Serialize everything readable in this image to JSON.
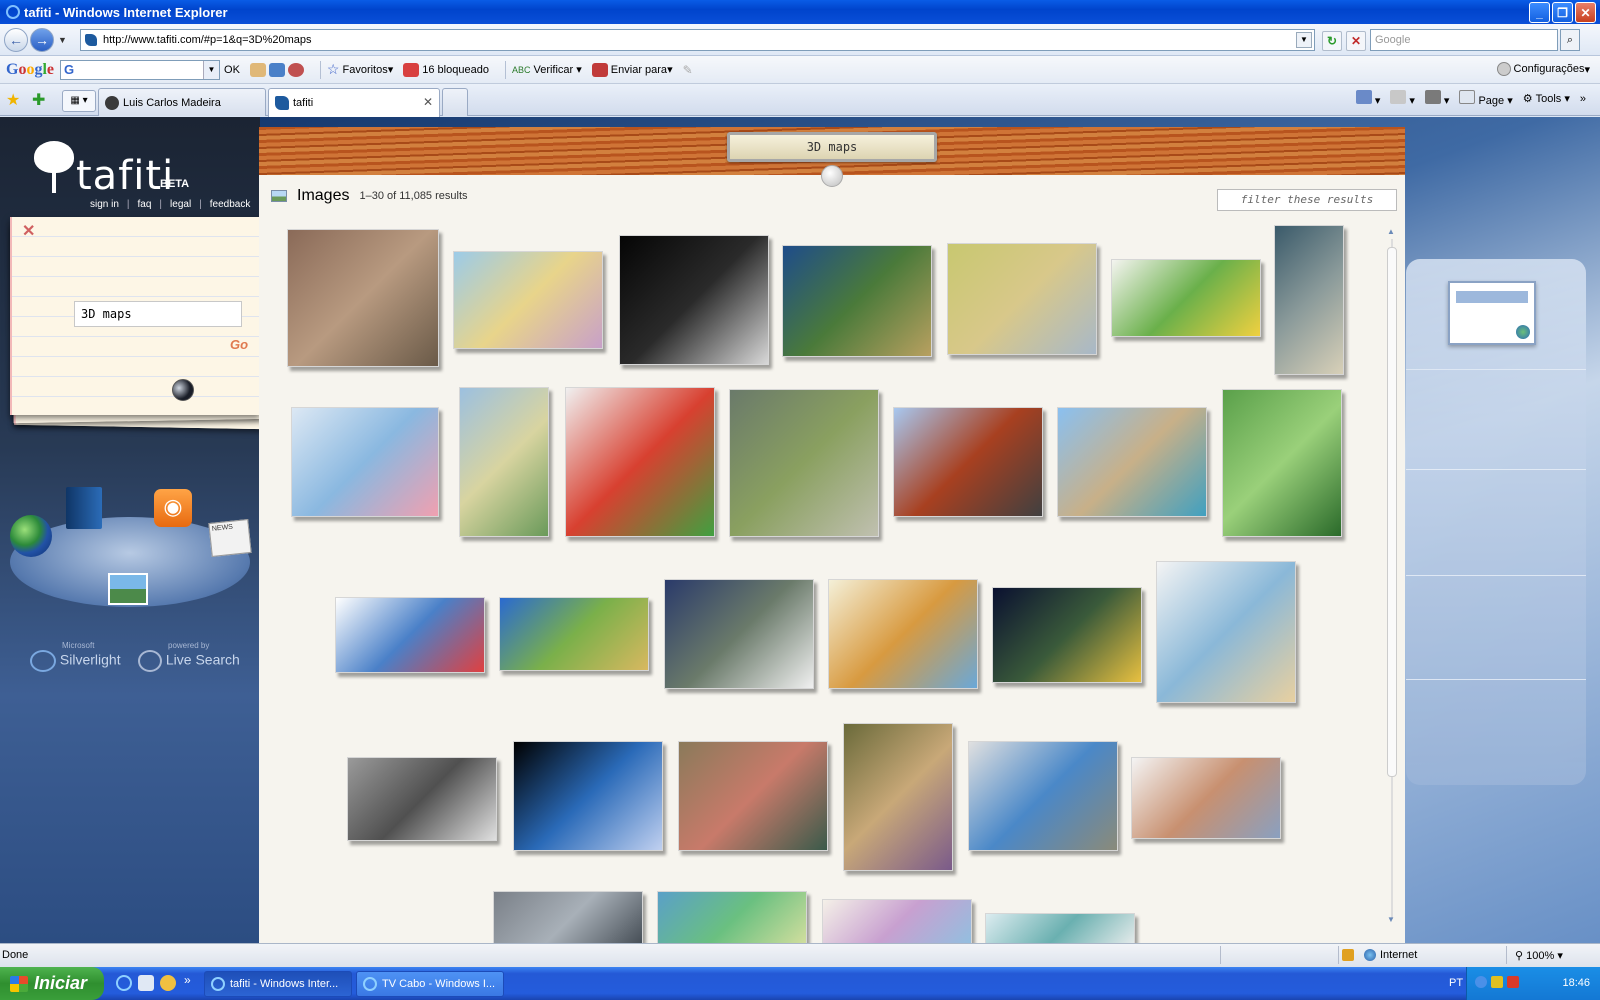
{
  "window": {
    "title": "tafiti - Windows Internet Explorer",
    "controls": {
      "minimize": "_",
      "maximize": "❐",
      "close": "✕"
    }
  },
  "address_bar": {
    "url": "http://www.tafiti.com/#p=1&q=3D%20maps",
    "search_placeholder": "Google",
    "back_glyph": "←",
    "forward_glyph": "→",
    "refresh_glyph": "↻",
    "stop_glyph": "✕",
    "search_glyph": "⌕"
  },
  "google_toolbar": {
    "logo_letters": [
      "G",
      "o",
      "o",
      "g",
      "l",
      "e"
    ],
    "ok_label": "OK",
    "favoritos_label": "Favoritos",
    "blocked_label": "16 bloqueado",
    "verificar_label": "Verificar",
    "enviar_label": "Enviar para",
    "configuracoes_label": "Configurações"
  },
  "tabs": [
    {
      "label": "Luis Carlos Madeira",
      "active": false
    },
    {
      "label": "tafiti",
      "active": true
    }
  ],
  "command_bar": {
    "page_label": "Page",
    "tools_label": "Tools"
  },
  "sidebar": {
    "logo_word": "tafiti",
    "logo_badge": "BETA",
    "links": [
      "sign in",
      "faq",
      "legal",
      "feedback"
    ],
    "search_value": "3D maps",
    "go_label": "Go",
    "news_label": "NEWS",
    "rss_glyph": "◉",
    "brands": {
      "silverlight_top": "Microsoft",
      "silverlight": "Silverlight",
      "live_top": "powered by",
      "live": "Live Search"
    }
  },
  "main": {
    "query_plaque": "3D maps",
    "section_label": "Images",
    "results_count": "1–30 of 11,085 results",
    "filter_placeholder": "filter these results",
    "thumbnails": [
      {
        "name": "aerial-city",
        "colors": [
          "#8a6a58",
          "#b89a80",
          "#6a5a48"
        ]
      },
      {
        "name": "world-political-map",
        "colors": [
          "#9ccbe8",
          "#e8d48a",
          "#c8a0c8"
        ]
      },
      {
        "name": "3d-render-shapes",
        "colors": [
          "#050505",
          "#2a2a2a",
          "#d8d8d8"
        ]
      },
      {
        "name": "island-relief",
        "colors": [
          "#1e4c8a",
          "#4a7a3a",
          "#b8a060"
        ]
      },
      {
        "name": "physiographic-map",
        "colors": [
          "#c8c870",
          "#d8c88a",
          "#a8b8c8"
        ]
      },
      {
        "name": "world-map-green",
        "colors": [
          "#f4f4f0",
          "#6ab04a",
          "#f0d040"
        ]
      },
      {
        "name": "island-game-map",
        "colors": [
          "#3a5a6a",
          "#8a9a9a",
          "#d8d0b8"
        ]
      },
      {
        "name": "liverpool-3d-map",
        "colors": [
          "#dce8f4",
          "#8ab8e0",
          "#f0a0b0"
        ]
      },
      {
        "name": "philippines-map",
        "colors": [
          "#9cc0e0",
          "#d8d4a0",
          "#6a9a5a"
        ]
      },
      {
        "name": "transit-map",
        "colors": [
          "#f0f0f0",
          "#d84030",
          "#40a040"
        ]
      },
      {
        "name": "game-city-map",
        "colors": [
          "#6a7a6a",
          "#8aa060",
          "#c0c0b0"
        ]
      },
      {
        "name": "cs-bikini-court",
        "colors": [
          "#a8c8f0",
          "#a84020",
          "#404040"
        ]
      },
      {
        "name": "cs-bikini-beach",
        "colors": [
          "#8ac0f0",
          "#c8b088",
          "#40a0c0"
        ]
      },
      {
        "name": "green-terrain",
        "colors": [
          "#5aa04a",
          "#9ad07a",
          "#2a6a2a"
        ]
      },
      {
        "name": "world-map-blue",
        "colors": [
          "#ffffff",
          "#4a80c8",
          "#e04040"
        ]
      },
      {
        "name": "world-physical-map",
        "colors": [
          "#2a6ad0",
          "#7ab04a",
          "#d8b860"
        ]
      },
      {
        "name": "mountain-route",
        "colors": [
          "#2a3a6a",
          "#6a7a6a",
          "#f0f0f0"
        ]
      },
      {
        "name": "mexico-relief",
        "colors": [
          "#f4f0d8",
          "#d89a40",
          "#6aa8d8"
        ]
      },
      {
        "name": "earth-night-lights",
        "colors": [
          "#0a1030",
          "#3a5a3a",
          "#e8c040"
        ]
      },
      {
        "name": "yarn-ball-globe",
        "colors": [
          "#f4f4f4",
          "#8ab8d8",
          "#e8d0a0"
        ]
      },
      {
        "name": "city-block-3d",
        "colors": [
          "#9a9a9a",
          "#505050",
          "#e0e0e0"
        ]
      },
      {
        "name": "globe-software",
        "colors": [
          "#000000",
          "#2a6ab8",
          "#c0d0f0"
        ]
      },
      {
        "name": "terrain-valley",
        "colors": [
          "#8a7a5a",
          "#c87a6a",
          "#3a5a4a"
        ]
      },
      {
        "name": "game-character",
        "colors": [
          "#6a6a3a",
          "#c8a878",
          "#7a5a8a"
        ]
      },
      {
        "name": "city-software-map",
        "colors": [
          "#e0e0e0",
          "#4a88c8",
          "#8a8a7a"
        ]
      },
      {
        "name": "campus-3d",
        "colors": [
          "#f4f4f4",
          "#c89070",
          "#8aa0c0"
        ]
      },
      {
        "name": "downtown-aerial",
        "colors": [
          "#7a8088",
          "#a8b0b8",
          "#404850"
        ]
      },
      {
        "name": "relief-blue-green",
        "colors": [
          "#5aa0c8",
          "#6ac080",
          "#d8e0a0"
        ]
      },
      {
        "name": "romania-map",
        "colors": [
          "#f4f0e8",
          "#c8a0d0",
          "#90c0e0"
        ]
      },
      {
        "name": "map-partial",
        "colors": [
          "#dcecf0",
          "#6ab0b0",
          "#f0f0f0"
        ]
      }
    ]
  },
  "statusbar": {
    "status": "Done",
    "zone": "Internet",
    "zoom": "100%"
  },
  "taskbar": {
    "start_label": "Iniciar",
    "tasks": [
      {
        "label": "tafiti - Windows Inter...",
        "active": true
      },
      {
        "label": "TV Cabo - Windows I...",
        "active": false
      }
    ],
    "language": "PT",
    "clock": "18:46"
  }
}
